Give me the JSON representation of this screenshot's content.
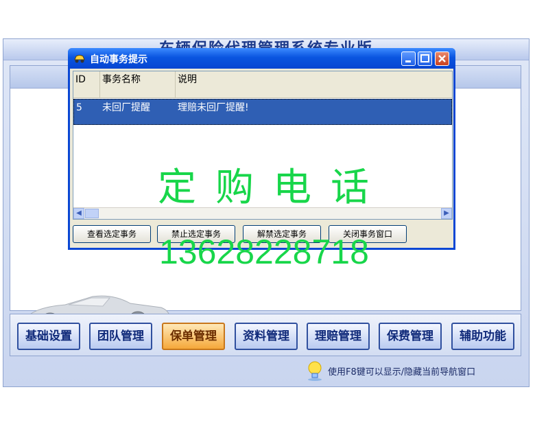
{
  "app": {
    "title": "车辆保险代理管理系统专业版"
  },
  "dialog": {
    "title": "自动事务提示",
    "columns": [
      "ID",
      "事务名称",
      "说明"
    ],
    "rows": [
      {
        "id": "5",
        "name": "未回厂提醒",
        "desc": "理赔未回厂提醒!"
      }
    ],
    "buttons": [
      "查看选定事务",
      "禁止选定事务",
      "解禁选定事务",
      "关闭事务窗口"
    ]
  },
  "watermark": {
    "text": "定购电话",
    "phone": "13628228718"
  },
  "nav": {
    "items": [
      {
        "label": "基础设置",
        "active": false
      },
      {
        "label": "团队管理",
        "active": false
      },
      {
        "label": "保单管理",
        "active": true
      },
      {
        "label": "资料管理",
        "active": false
      },
      {
        "label": "理赔管理",
        "active": false
      },
      {
        "label": "保费管理",
        "active": false
      },
      {
        "label": "辅助功能",
        "active": false
      }
    ]
  },
  "hint": {
    "text": "使用F8键可以显示/隐藏当前导航窗口"
  },
  "colors": {
    "titlebar": "#0a55e0",
    "selection": "#2f5fb4",
    "watermark": "#18d64a",
    "nav_active": "#f5a83a"
  }
}
